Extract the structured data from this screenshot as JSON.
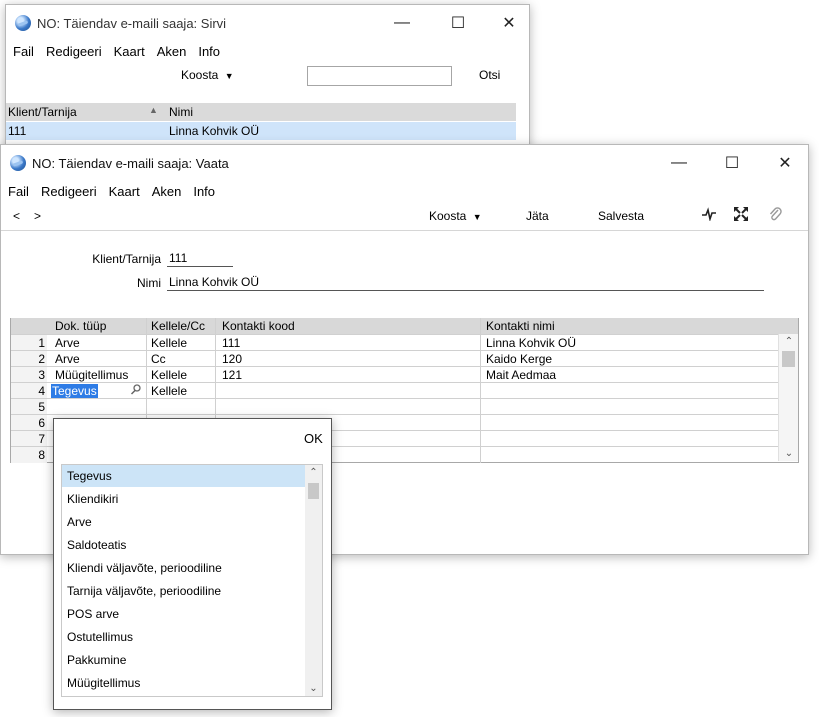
{
  "browse_window": {
    "title": "NO: Täiendav e-maili saaja: Sirvi",
    "menu": [
      "Fail",
      "Redigeeri",
      "Kaart",
      "Aken",
      "Info"
    ],
    "koosta_label": "Koosta",
    "search_value": "",
    "search_button": "Otsi",
    "columns": [
      "Klient/Tarnija",
      "Nimi"
    ],
    "rows": [
      {
        "code": "111",
        "name": "Linna Kohvik OÜ"
      }
    ]
  },
  "view_window": {
    "title": "NO: Täiendav e-maili saaja: Vaata",
    "menu": [
      "Fail",
      "Redigeeri",
      "Kaart",
      "Aken",
      "Info"
    ],
    "toolbar": {
      "prev": "<",
      "next": ">",
      "koosta": "Koosta",
      "jata": "Jäta",
      "salvesta": "Salvesta"
    },
    "fields": {
      "client_label": "Klient/Tarnija",
      "client_value": "111",
      "name_label": "Nimi",
      "name_value": "Linna Kohvik OÜ"
    },
    "grid": {
      "columns": [
        "Dok. tüüp",
        "Kellele/Cc",
        "Kontakti kood",
        "Kontakti nimi"
      ],
      "rows": [
        {
          "n": "1",
          "doc": "Arve",
          "to": "Kellele",
          "code": "111",
          "contact": "Linna Kohvik OÜ"
        },
        {
          "n": "2",
          "doc": "Arve",
          "to": "Cc",
          "code": "120",
          "contact": "Kaido Kerge"
        },
        {
          "n": "3",
          "doc": "Müügitellimus",
          "to": "Kellele",
          "code": "121",
          "contact": "Mait Aedmaa"
        },
        {
          "n": "4",
          "doc": "Tegevus",
          "to": "Kellele",
          "code": "",
          "contact": ""
        },
        {
          "n": "5",
          "doc": "",
          "to": "",
          "code": "",
          "contact": ""
        },
        {
          "n": "6",
          "doc": "",
          "to": "",
          "code": "",
          "contact": ""
        },
        {
          "n": "7",
          "doc": "",
          "to": "",
          "code": "",
          "contact": ""
        },
        {
          "n": "8",
          "doc": "",
          "to": "",
          "code": "",
          "contact": ""
        }
      ]
    }
  },
  "popup": {
    "ok_label": "OK",
    "items": [
      "Tegevus",
      "Kliendikiri",
      "Arve",
      "Saldoteatis",
      "Kliendi väljavõte, perioodiline",
      "Tarnija väljavõte, perioodiline",
      "POS arve",
      "Ostutellimus",
      "Pakkumine",
      "Müügitellimus"
    ],
    "selected": "Tegevus"
  }
}
